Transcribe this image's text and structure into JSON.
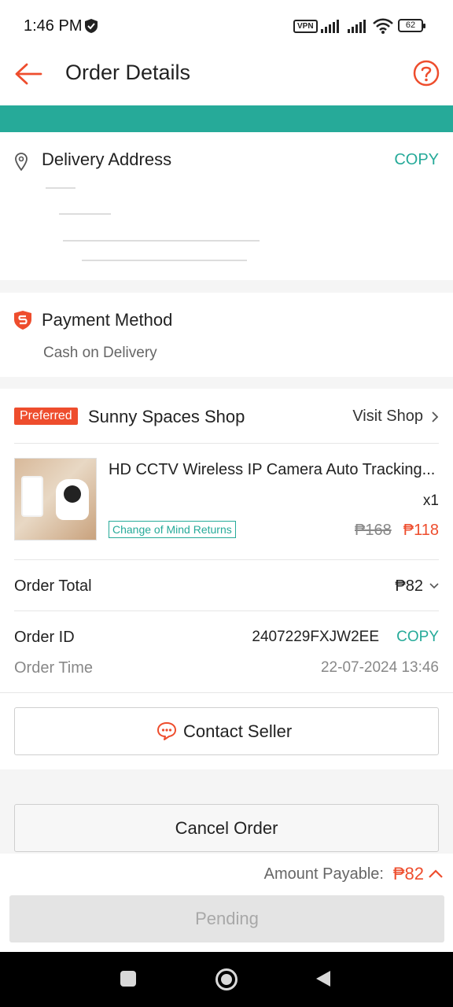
{
  "status_bar": {
    "time": "1:46 PM",
    "vpn": "VPN",
    "battery": "62"
  },
  "header": {
    "title": "Order Details",
    "back_icon": "back-arrow-icon",
    "help_icon": "help-icon"
  },
  "delivery": {
    "label": "Delivery Address",
    "copy": "COPY"
  },
  "payment": {
    "label": "Payment Method",
    "value": "Cash on Delivery"
  },
  "shop": {
    "badge": "Preferred",
    "name": "Sunny Spaces Shop",
    "visit": "Visit Shop"
  },
  "product": {
    "name": "HD CCTV Wireless IP Camera Auto Tracking...",
    "quantity": "x1",
    "tag": "Change of Mind Returns",
    "original_price": "₱168",
    "price": "₱118"
  },
  "order": {
    "total_label": "Order Total",
    "total_value": "₱82",
    "id_label": "Order ID",
    "id_value": "2407229FXJW2EE",
    "id_copy": "COPY",
    "time_label": "Order Time",
    "time_value": "22-07-2024 13:46"
  },
  "actions": {
    "contact": "Contact Seller",
    "cancel": "Cancel Order"
  },
  "footer": {
    "payable_label": "Amount Payable:",
    "payable_value": "₱82",
    "status_button": "Pending"
  },
  "colors": {
    "accent": "#ee4d2d",
    "teal": "#26aa99"
  }
}
